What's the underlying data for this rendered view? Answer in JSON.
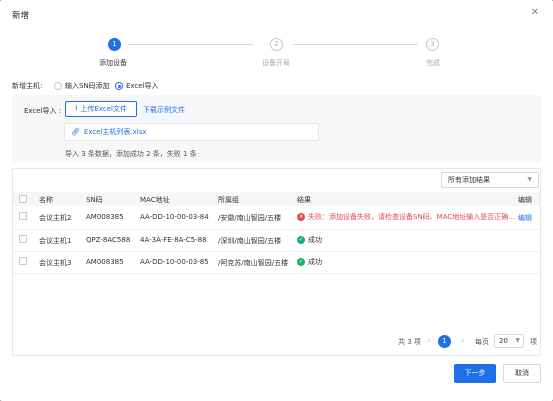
{
  "dialog": {
    "title": "新增",
    "close_icon": "close-icon"
  },
  "steps": [
    {
      "num": "1",
      "label": "添加设备",
      "state": "active"
    },
    {
      "num": "2",
      "label": "设备开局",
      "state": "idle"
    },
    {
      "num": "3",
      "label": "完成",
      "state": "idle"
    }
  ],
  "mode": {
    "label": "新增主机:",
    "options": [
      {
        "label": "输入SN码添加",
        "selected": false
      },
      {
        "label": "Excel导入",
        "selected": true
      }
    ]
  },
  "import": {
    "label": "Excel导入 :",
    "upload_button": "上传Excel文件",
    "upload_icon": "upload-icon",
    "download_link": "下载示例文件",
    "file_name": "Excel主机列表.xlsx",
    "file_icon": "link-icon",
    "summary": "导入 3 条数据，添加成功 2 条，失败 1 条"
  },
  "filter": {
    "value": "所有添加结果"
  },
  "table": {
    "headers": [
      "名称",
      "SN码",
      "MAC地址",
      "所属组",
      "结果",
      "编辑"
    ],
    "rows": [
      {
        "name": "会议主机2",
        "sn": "AM008385",
        "mac": "AA-DD-10-00-03-84",
        "group": "/安徽/南山智园/五楼",
        "result": "失败：添加设备失败，请检查设备SN码、MAC地址输入是否正确...",
        "status": "fail",
        "action": "编辑"
      },
      {
        "name": "会议主机1",
        "sn": "QPZ-8AC588",
        "mac": "4A-3A-FE-8A-C5-88",
        "group": "/深圳/南山智园/五楼",
        "result": "成功",
        "status": "success",
        "action": ""
      },
      {
        "name": "会议主机3",
        "sn": "AM008385",
        "mac": "AA-DD-10-00-03-85",
        "group": "/阿克苏/南山智园/五楼",
        "result": "成功",
        "status": "success",
        "action": ""
      }
    ]
  },
  "pagination": {
    "total": "共 3 项",
    "current": "1",
    "per_page_label": "每页",
    "page_size": "20",
    "unit": "项"
  },
  "footer": {
    "next": "下一步",
    "cancel": "取消"
  },
  "colors": {
    "accent": "#1f6fe8",
    "error": "#e34b4b",
    "success": "#17b26a"
  }
}
